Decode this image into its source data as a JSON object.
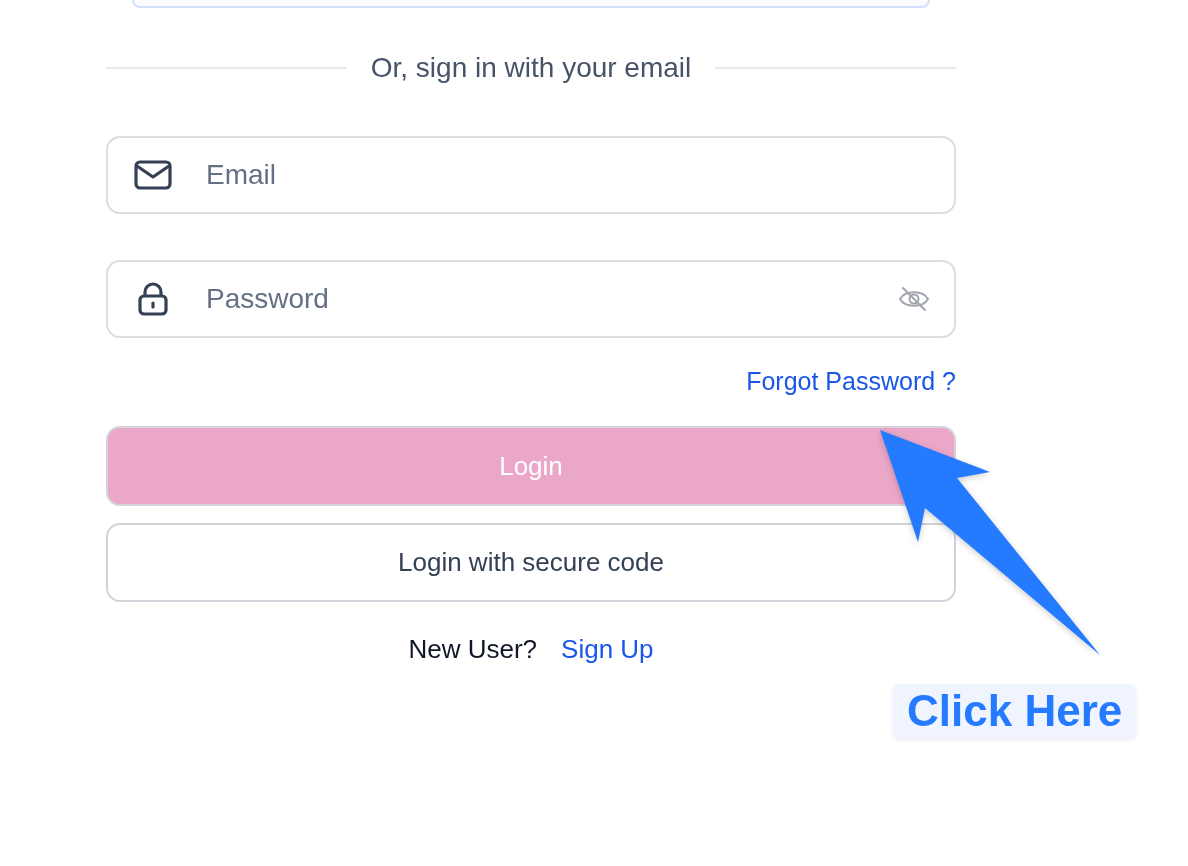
{
  "divider_text": "Or, sign in with your email",
  "fields": [
    {
      "kind": "email",
      "placeholder": "Email"
    },
    {
      "kind": "password",
      "placeholder": "Password",
      "password_visible": false
    }
  ],
  "forgot_link": "Forgot Password ?",
  "login_button": {
    "label": "Login",
    "disabled": true
  },
  "secure_code_button": {
    "label": "Login with secure code"
  },
  "signup_prompt": {
    "text": "New User?",
    "link": "Sign Up"
  },
  "callout": {
    "label": "Click Here"
  }
}
